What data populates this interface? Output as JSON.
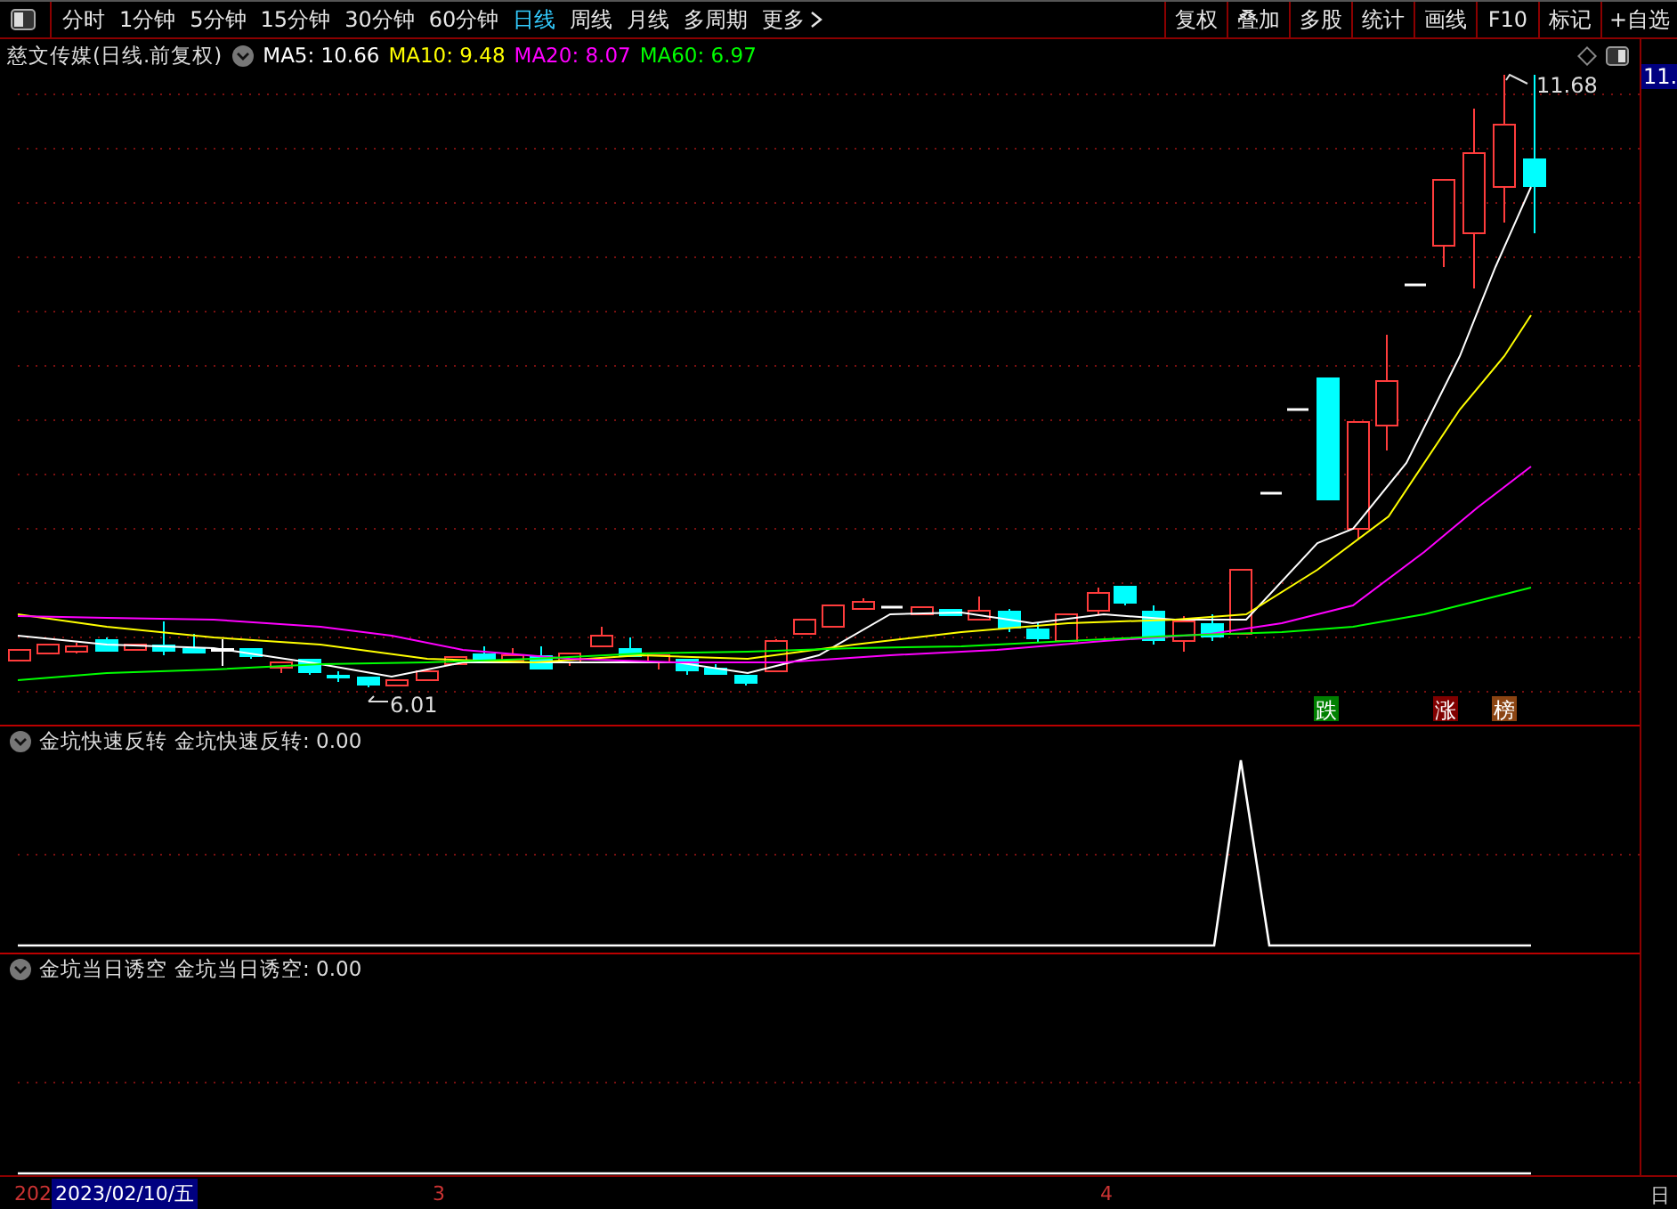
{
  "toolbar": {
    "periods": [
      {
        "label": "分时",
        "selected": false
      },
      {
        "label": "1分钟",
        "selected": false
      },
      {
        "label": "5分钟",
        "selected": false
      },
      {
        "label": "15分钟",
        "selected": false
      },
      {
        "label": "30分钟",
        "selected": false
      },
      {
        "label": "60分钟",
        "selected": false
      },
      {
        "label": "日线",
        "selected": true
      },
      {
        "label": "周线",
        "selected": false
      },
      {
        "label": "月线",
        "selected": false
      },
      {
        "label": "多周期",
        "selected": false
      },
      {
        "label": "更多",
        "selected": false
      }
    ],
    "actions": [
      "复权",
      "叠加",
      "多股",
      "统计",
      "画线",
      "F10",
      "标记",
      "+自选"
    ]
  },
  "main_chart": {
    "title": "慈文传媒(日线.前复权)",
    "indicators": [
      {
        "label": "MA5: 10.66",
        "color": "#ffffff"
      },
      {
        "label": "MA10: 9.48",
        "color": "#ffff00"
      },
      {
        "label": "MA20: 8.07",
        "color": "#ff00ff"
      },
      {
        "label": "MA60: 6.97",
        "color": "#00ff00"
      }
    ],
    "high_label": "11.68",
    "low_label": "6.01",
    "markers": [
      {
        "text": "跌",
        "color": "#008000"
      },
      {
        "text": "涨",
        "color": "#800000"
      },
      {
        "text": "榜",
        "color": "#8b4513"
      }
    ],
    "price_tag": "11."
  },
  "panels": [
    {
      "title": "金坑快速反转",
      "value": "金坑快速反转: 0.00"
    },
    {
      "title": "金坑当日诱空",
      "value": "金坑当日诱空: 0.00"
    }
  ],
  "x_axis": {
    "labels": [
      "202",
      "3",
      "4"
    ],
    "cursor_date": "2023/02/10/五",
    "corner": "日"
  }
}
